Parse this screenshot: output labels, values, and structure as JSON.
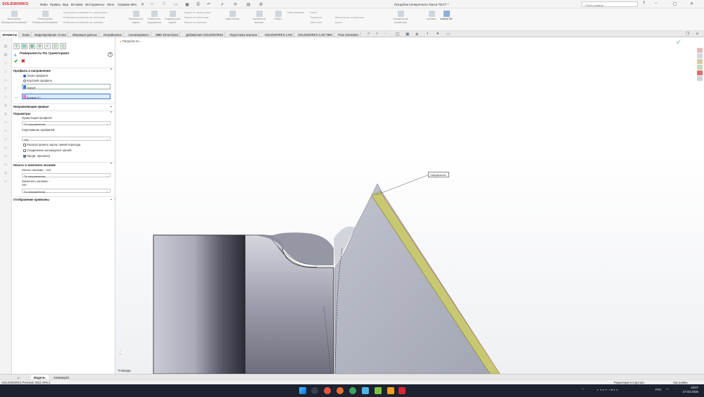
{
  "app": {
    "logo": "SOLIDWORKS",
    "title": "Патрубок поперечного бокса ТЕСТ *"
  },
  "menu": [
    "Файл",
    "Правка",
    "Вид",
    "Вставка",
    "Инструменты",
    "Окно",
    "Справка 90%"
  ],
  "search": {
    "placeholder": "Поиск команд"
  },
  "ribbon": [
    {
      "label": "Вытянутая бобышка/основание",
      "icon": "extrude-boss-icon"
    },
    {
      "label": "Повернутая бобышка/основание",
      "icon": "revolve-boss-icon"
    },
    {
      "label": "Вытянутый вырез",
      "icon": "extrude-cut-icon"
    },
    {
      "label": "Отверстие под крепеж",
      "icon": "hole-wizard-icon"
    },
    {
      "label": "Повернутый вырез",
      "icon": "revolve-cut-icon"
    },
    {
      "label": "Скругление",
      "icon": "fillet-icon"
    },
    {
      "label": "Линейный массив",
      "icon": "linear-pattern-icon"
    },
    {
      "label": "Ребро",
      "icon": "rib-icon"
    },
    {
      "label": "Уклон",
      "icon": "draft-icon"
    },
    {
      "label": "Оболочка",
      "icon": "shell-icon"
    },
    {
      "label": "Справочная геометрия",
      "icon": "ref-geometry-icon"
    },
    {
      "label": "Кривые",
      "icon": "curves-icon"
    },
    {
      "label": "Instant 3D",
      "icon": "instant3d-icon"
    }
  ],
  "ribbon_small": [
    "Бобышка/основание по траектории",
    "Бобышка/основание по сечениям",
    "Бобышка/основание на границе",
    "Вырез по траектории",
    "Вырез по сечениям",
    "Вырез по границе",
    "Обертывание",
    "Пересечь",
    "Зеркальное отражение",
    "Купол"
  ],
  "tabs": [
    "Элементы",
    "Эскиз",
    "Моделирование оттиск",
    "Миграция данных",
    "Исправление",
    "Анализировать",
    "MBD Dimensions",
    "Добавления SOLIDWORKS",
    "Подготовка анализа",
    "SOLIDWORKS CAM",
    "SOLIDWORKS CAM TBM",
    "Flow Simulation"
  ],
  "feature_tree": {
    "root": "Патрубок по..."
  },
  "property_manager": {
    "title": "Поверхность-По траектории1",
    "section_profile": "Профиль и направление",
    "radio_sketch": "Эскиз профиля",
    "radio_circle": "Круговой профиль",
    "field_profile": "Эскиз9",
    "field_path": "Кромка<1>",
    "section_guides": "Направляющие кривые",
    "section_params": "Параметры",
    "orient_label": "Ориентация профиля:",
    "orient_value": "По направлению",
    "twist_label": "Скручивание профилей:",
    "twist_value": "Нет",
    "chk_propagate": "Распространить вдоль линий перехода",
    "chk_merge": "Соединение касающихся граней",
    "chk_preview": "Предв. просмотр",
    "section_tangency": "Начать и закончить касание",
    "start_label": "Начать касание - тип:",
    "start_value": "По направлению",
    "end_label": "Закончить касание - тип:",
    "end_value": "По направлению",
    "section_curvature": "Отображение кривизны"
  },
  "viewport": {
    "callout": "Направление",
    "view_label": "*Спереди"
  },
  "bottom_tabs": [
    "Модель",
    "Анимация1"
  ],
  "status": {
    "left": "SOLIDWORKS Premium 2023 SP5.2",
    "right": "Редактируется Деталь",
    "units": "Настройка"
  },
  "taskbar": {
    "time": "18:57",
    "date": "27.03.2026",
    "lang": "РУС"
  },
  "colors": {
    "accent": "#3a7bd5",
    "path_highlight": "#c8c873",
    "taskbar": "#1c2230"
  }
}
